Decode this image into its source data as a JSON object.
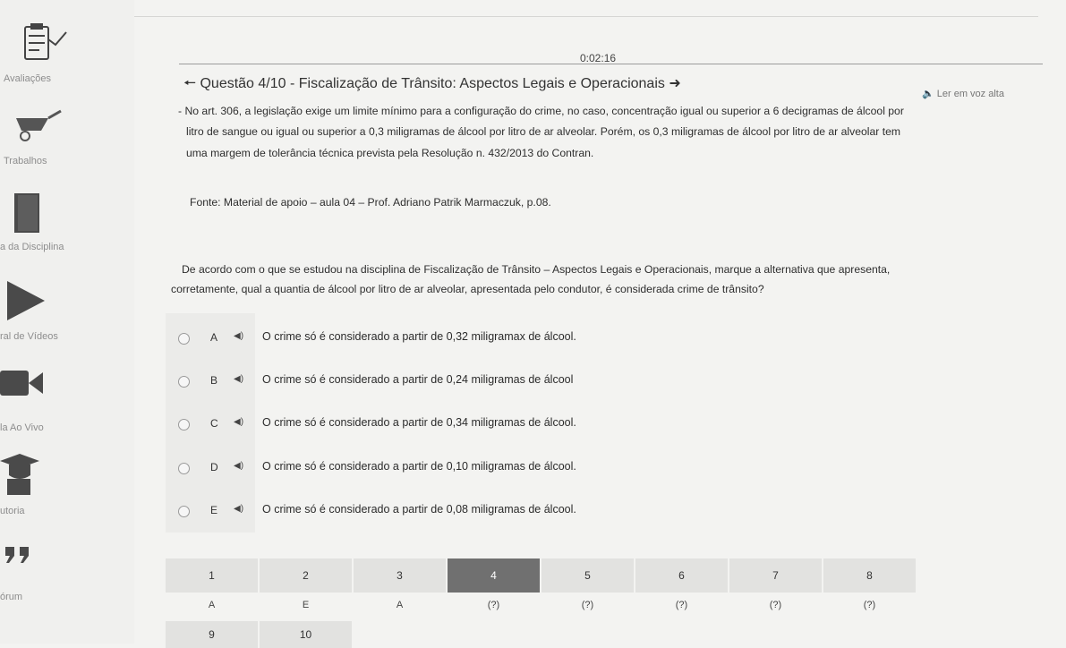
{
  "sidebar": {
    "items": [
      {
        "label": "Avaliações",
        "icon": "clipboard-check-icon"
      },
      {
        "label": "Trabalhos",
        "icon": "wheelbarrow-icon"
      },
      {
        "label": "a da Disciplina",
        "icon": "book-icon"
      },
      {
        "label": "ral de Vídeos",
        "icon": "play-icon"
      },
      {
        "label": "la Ao Vivo",
        "icon": "video-camera-icon"
      },
      {
        "label": "utoria",
        "icon": "graduation-cap-icon"
      },
      {
        "label": "órum",
        "icon": "quote-icon"
      }
    ]
  },
  "timer": "0:02:16",
  "question": {
    "prev_icon": "arrow-left-icon",
    "title": "Questão 4/10 - Fiscalização de Trânsito: Aspectos Legais e Operacionais",
    "next_icon": "arrow-right-icon",
    "read_aloud": "Ler em voz alta",
    "context_lines": [
      "- No art. 306, a legislação exige um limite mínimo para a configuração do crime, no caso, concentração igual ou superior a 6 decigramas de álcool por",
      "litro de sangue ou igual ou superior a 0,3 miligramas de álcool por litro de ar alveolar. Porém, os 0,3 miligramas de álcool por litro de ar alveolar tem",
      "uma margem de tolerância técnica prevista pela Resolução n. 432/2013 do Contran."
    ],
    "source": "Fonte: Material de apoio – aula 04 – Prof. Adriano Patrik Marmaczuk, p.08.",
    "prompt_lines": [
      "De acordo com o que se estudou na disciplina de Fiscalização de Trânsito – Aspectos Legais e Operacionais, marque a alternativa que apresenta,",
      "corretamente, qual a quantia de álcool por litro de ar alveolar, apresentada pelo condutor, é considerada crime de trânsito?"
    ],
    "options": [
      {
        "letter": "A",
        "text": "O crime só é considerado a partir de 0,32 miligramax de álcool."
      },
      {
        "letter": "B",
        "text": "O crime só é considerado a partir de 0,24 miligramas de álcool"
      },
      {
        "letter": "C",
        "text": "O crime só é considerado a partir de 0,34 miligramas de álcool."
      },
      {
        "letter": "D",
        "text": "O crime só é considerado a partir de 0,10 miligramas de álcool."
      },
      {
        "letter": "E",
        "text": "O crime só é considerado a partir de 0,08 miligramas de álcool."
      }
    ]
  },
  "pagination": {
    "pages": [
      {
        "num": "1",
        "answer": "A"
      },
      {
        "num": "2",
        "answer": "E"
      },
      {
        "num": "3",
        "answer": "A"
      },
      {
        "num": "4",
        "answer": "(?)"
      },
      {
        "num": "5",
        "answer": "(?)"
      },
      {
        "num": "6",
        "answer": "(?)"
      },
      {
        "num": "7",
        "answer": "(?)"
      },
      {
        "num": "8",
        "answer": "(?)"
      }
    ],
    "second_row": [
      "9",
      "10"
    ],
    "active_index": 3
  }
}
